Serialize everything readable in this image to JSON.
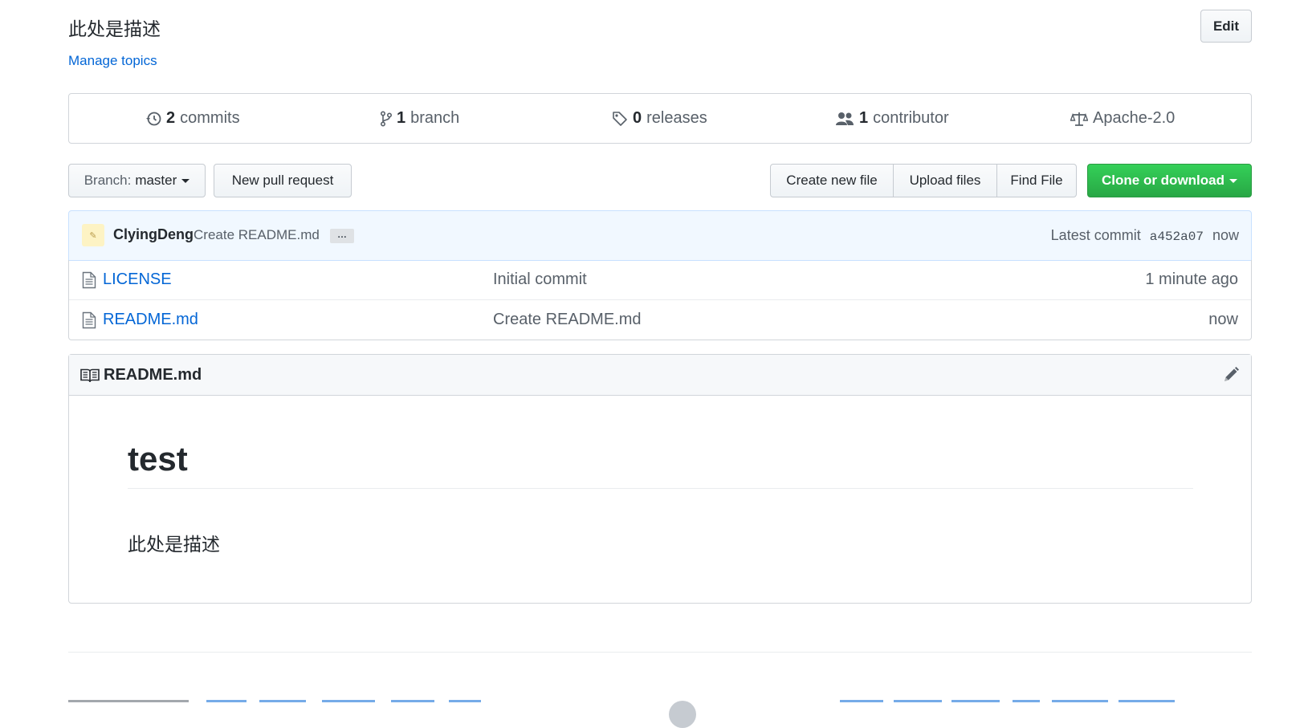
{
  "repo": {
    "description": "此处是描述",
    "manage_topics": "Manage topics",
    "edit_label": "Edit"
  },
  "summary": {
    "commits": {
      "num": "2",
      "label": "commits"
    },
    "branches": {
      "num": "1",
      "label": "branch"
    },
    "releases": {
      "num": "0",
      "label": "releases"
    },
    "contributors": {
      "num": "1",
      "label": "contributor"
    },
    "license": "Apache-2.0"
  },
  "toolbar": {
    "branch_prefix": "Branch:",
    "branch_name": "master",
    "new_pull_request": "New pull request",
    "create_new_file": "Create new file",
    "upload_files": "Upload files",
    "find_file": "Find File",
    "clone_or_download": "Clone or download"
  },
  "latest_commit": {
    "author": "ClyingDeng",
    "message": "Create README.md",
    "ellipsis": "…",
    "prefix": "Latest commit",
    "sha": "a452a07",
    "age": "now"
  },
  "files": [
    {
      "name": "LICENSE",
      "message": "Initial commit",
      "age": "1 minute ago"
    },
    {
      "name": "README.md",
      "message": "Create README.md",
      "age": "now"
    }
  ],
  "readme": {
    "header": "README.md",
    "h1": "test",
    "paragraph": "此处是描述"
  },
  "colors": {
    "link": "#0366d6",
    "primary_green": "#28a745",
    "commit_bar_bg": "#f1f8ff"
  }
}
